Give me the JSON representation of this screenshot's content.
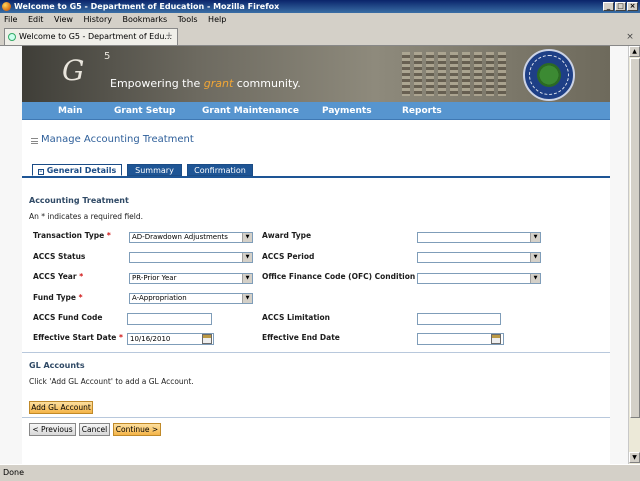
{
  "window": {
    "title": "Welcome to G5 - Department of Education - Mozilla Firefox",
    "controls": [
      "_",
      "□",
      "×"
    ]
  },
  "menu": [
    "File",
    "Edit",
    "View",
    "History",
    "Bookmarks",
    "Tools",
    "Help"
  ],
  "browser_tab": {
    "label": "Welcome to G5 - Department of Edu...",
    "close": "×",
    "new_tab": "+",
    "close_right": "×"
  },
  "banner": {
    "logo_letter": "G",
    "logo_sup": "5",
    "slogan_pre": "Empowering the ",
    "slogan_accent": "grant",
    "slogan_post": " community."
  },
  "nav": [
    "Main",
    "Grant Setup",
    "Grant Maintenance",
    "Payments",
    "Reports"
  ],
  "page_title": "Manage Accounting Treatment",
  "tabs": {
    "general_box": "–",
    "general": "General Details",
    "summary": "Summary",
    "confirmation": "Confirmation"
  },
  "form": {
    "section_title": "Accounting Treatment",
    "required_note": "An * indicates a required field.",
    "req_mark": "*",
    "transaction_type": {
      "label": "Transaction Type",
      "value": "AD-Drawdown Adjustments"
    },
    "award_type": {
      "label": "Award Type",
      "value": ""
    },
    "accs_status": {
      "label": "ACCS Status",
      "value": ""
    },
    "accs_period": {
      "label": "ACCS Period",
      "value": ""
    },
    "accs_year": {
      "label": "ACCS Year",
      "value": "PR-Prior Year"
    },
    "ofc_condition": {
      "label": "Office Finance Code (OFC) Condition",
      "value": ""
    },
    "fund_type": {
      "label": "Fund Type",
      "value": "A-Appropriation"
    },
    "accs_fund_code": {
      "label": "ACCS Fund Code",
      "value": ""
    },
    "accs_limitation": {
      "label": "ACCS Limitation",
      "value": ""
    },
    "effective_start": {
      "label": "Effective Start Date",
      "value": "10/16/2010"
    },
    "effective_end": {
      "label": "Effective End Date",
      "value": ""
    },
    "select_arrow": "▼"
  },
  "gl": {
    "title": "GL Accounts",
    "hint": "Click 'Add GL Account' to add a GL Account.",
    "add_button": "Add GL Account"
  },
  "buttons": {
    "previous": "< Previous",
    "cancel": "Cancel",
    "continue": "Continue >"
  },
  "status": "Done",
  "scroll": {
    "up": "▲",
    "down": "▼"
  }
}
